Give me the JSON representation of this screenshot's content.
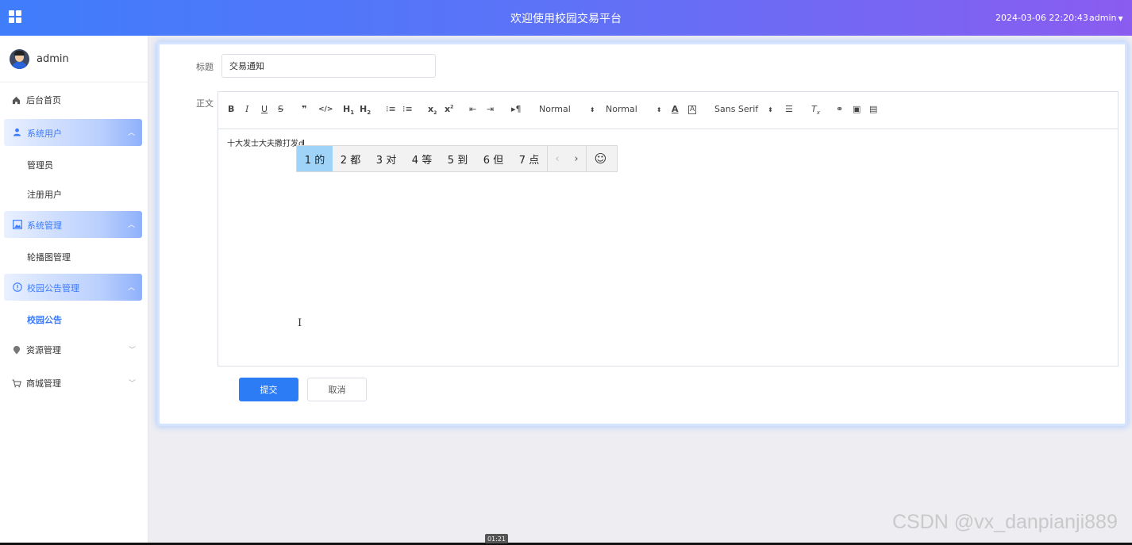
{
  "header": {
    "title": "欢迎使用校园交易平台",
    "datetime": "2024-03-06 22:20:43",
    "user": "admin",
    "user_caret": "⌄"
  },
  "sidebar": {
    "user_name": "admin",
    "home": "后台首页",
    "groups": [
      {
        "label": "系统用户",
        "expanded": true,
        "items": [
          "管理员",
          "注册用户"
        ]
      },
      {
        "label": "系统管理",
        "expanded": true,
        "items": [
          "轮播图管理"
        ]
      },
      {
        "label": "校园公告管理",
        "expanded": true,
        "items": [
          "校园公告"
        ]
      }
    ],
    "collapsed": [
      "资源管理",
      "商城管理"
    ],
    "active_item": "校园公告"
  },
  "form": {
    "title_label": "标题",
    "title_value": "交易通知",
    "body_label": "正文",
    "body_text": "十大发士大夫撒打发d",
    "submit_label": "提交",
    "cancel_label": "取消"
  },
  "toolbar": {
    "header_picker": "Normal",
    "size_picker": "Normal",
    "font_picker": "Sans Serif"
  },
  "ime": {
    "candidates": [
      "1 的",
      "2 都",
      "3 对",
      "4 等",
      "5 到",
      "6 但",
      "7 点"
    ],
    "selected_index": 0
  },
  "overlay": {
    "watermark": "CSDN @vx_danpianji889",
    "video_time": "01:21"
  },
  "colors": {
    "accent": "#3a7afe",
    "header_gradient_start": "#3f7dfb",
    "header_gradient_end": "#8a5cf0",
    "primary_button": "#2c7cf6"
  }
}
